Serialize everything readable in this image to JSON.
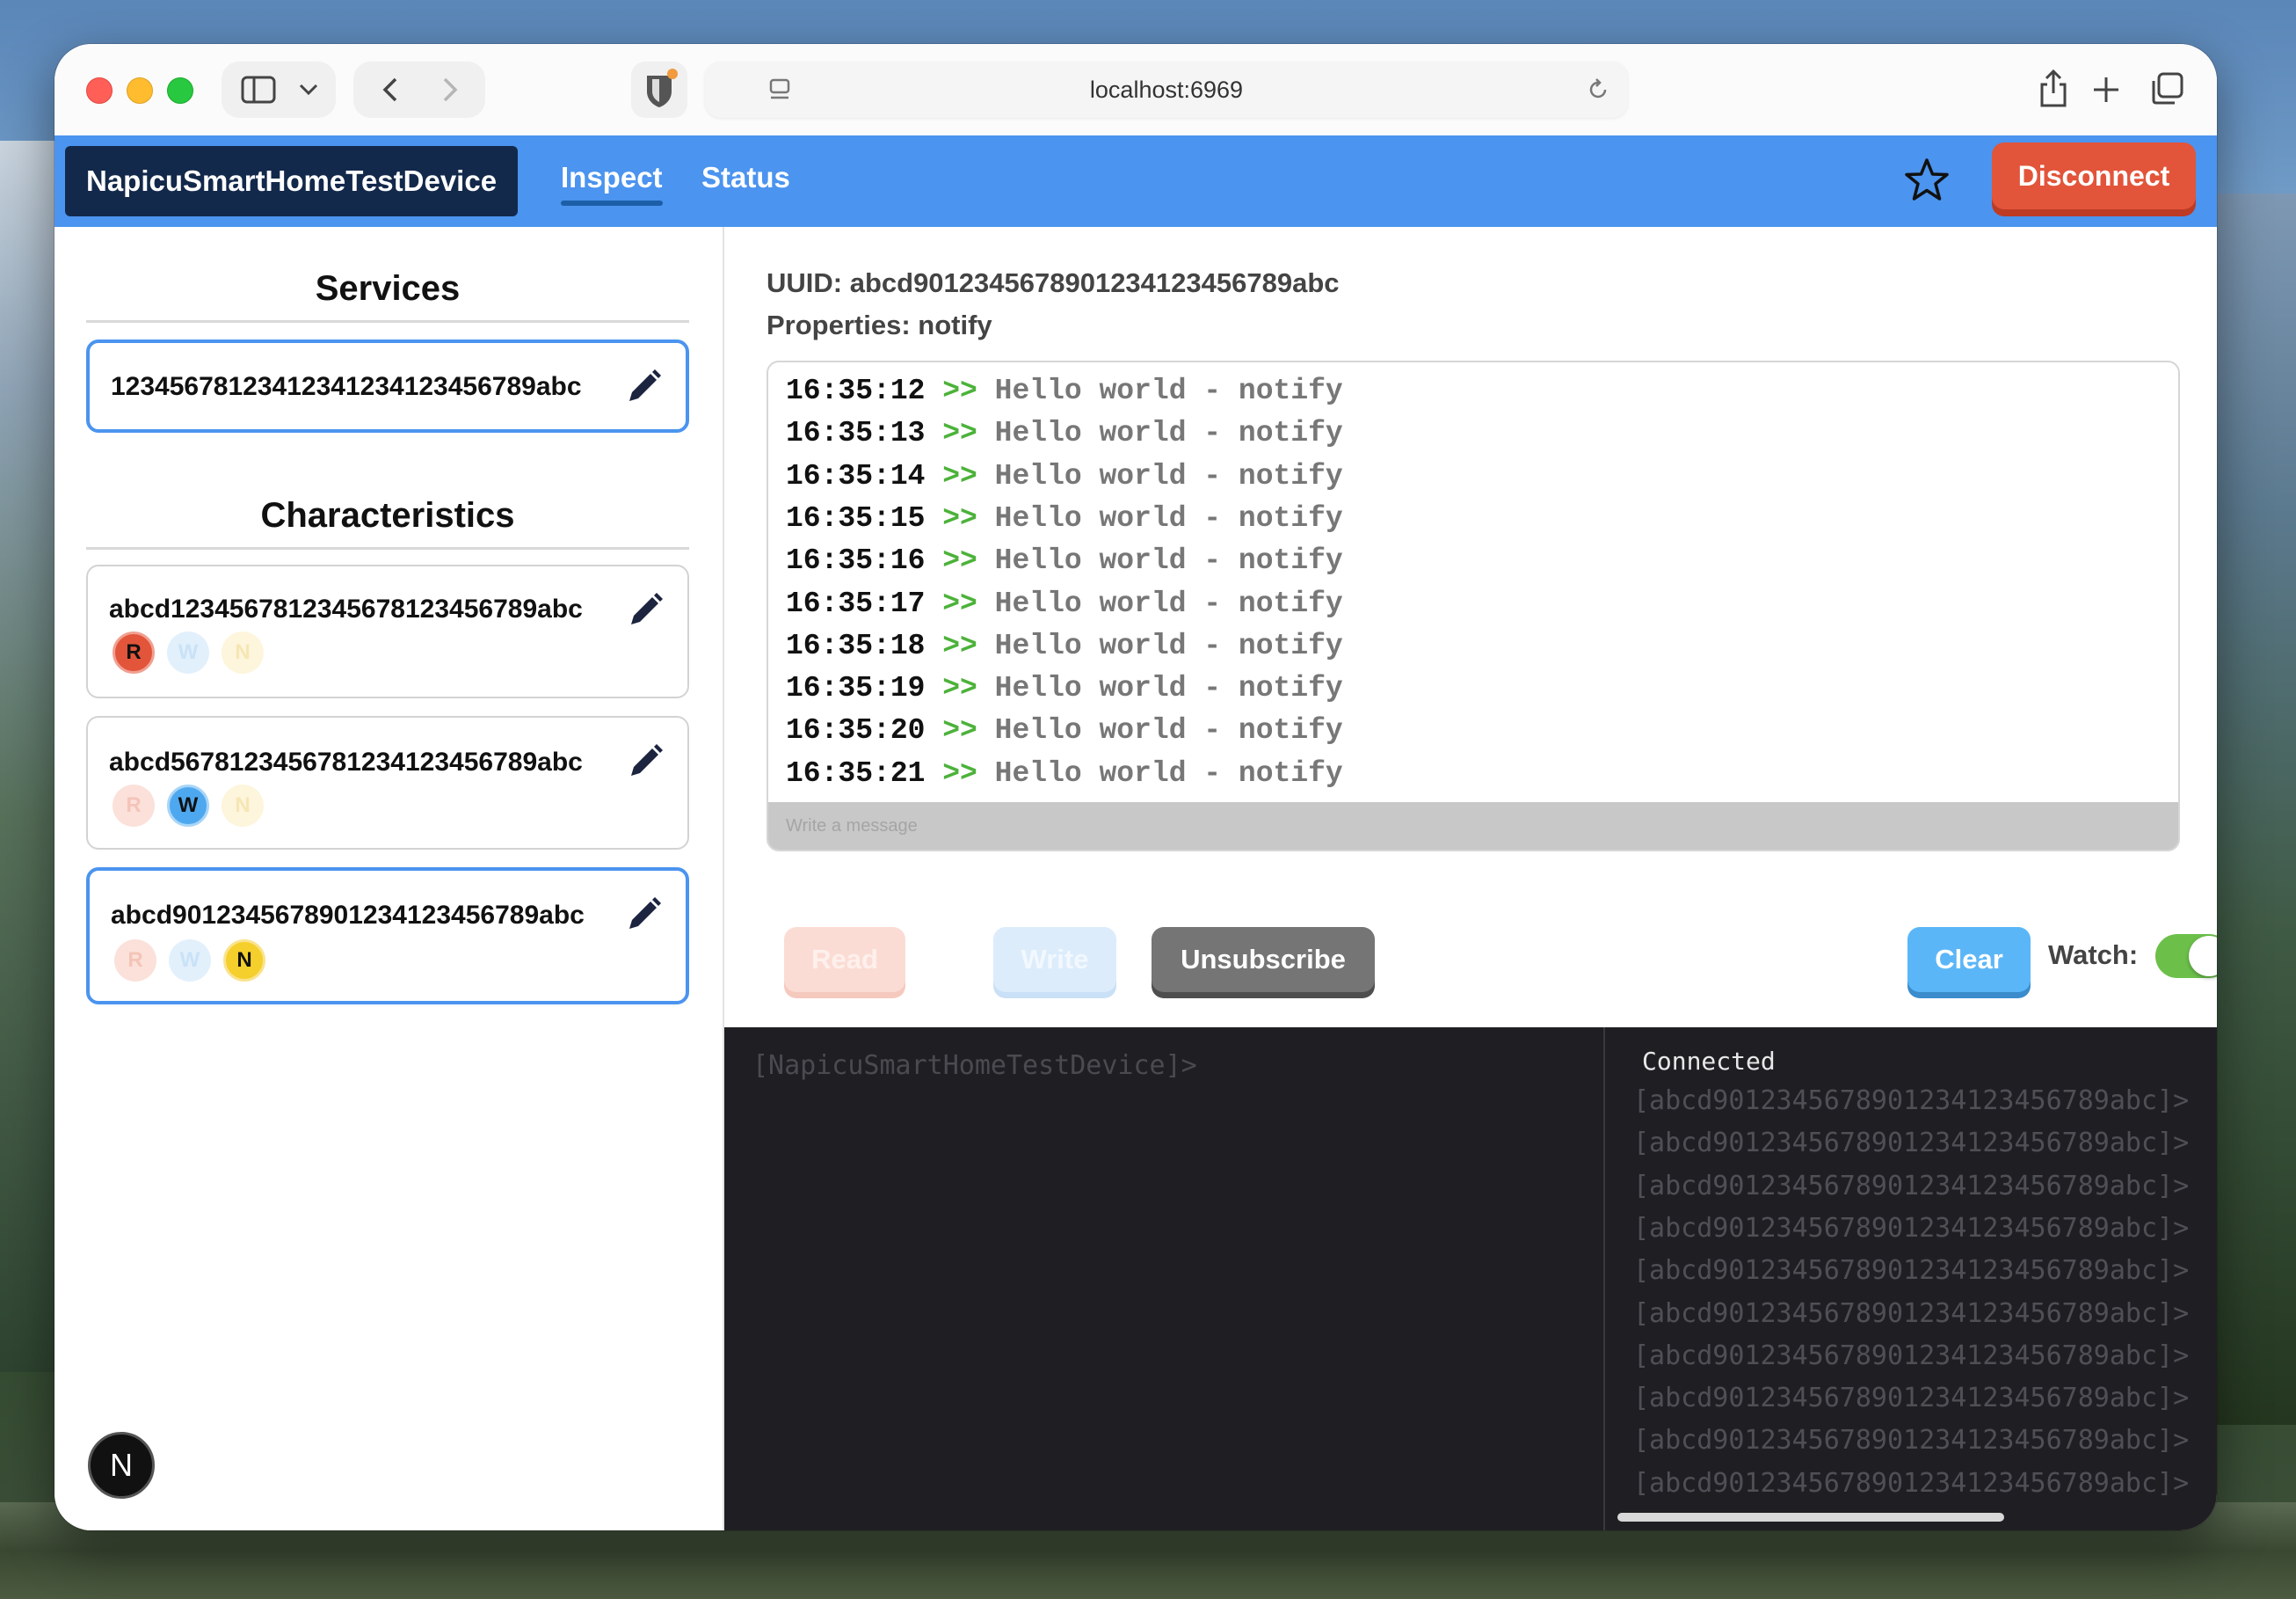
{
  "browser": {
    "url": "localhost:6969"
  },
  "header": {
    "device_name": "NapicuSmartHomeTestDevice",
    "tabs": [
      {
        "label": "Inspect",
        "active": true
      },
      {
        "label": "Status",
        "active": false
      }
    ],
    "disconnect_label": "Disconnect"
  },
  "services": {
    "title": "Services",
    "items": [
      {
        "uuid": "12345678123412341234123456789abc"
      }
    ]
  },
  "characteristics": {
    "title": "Characteristics",
    "items": [
      {
        "uuid": "abcd1234567812345678123456789abc",
        "badges": [
          "R",
          "W",
          "N"
        ],
        "active": [
          "R"
        ]
      },
      {
        "uuid": "abcd5678123456781234123456789abc",
        "badges": [
          "R",
          "W",
          "N"
        ],
        "active": [
          "W"
        ]
      },
      {
        "uuid": "abcd9012345678901234123456789abc",
        "badges": [
          "R",
          "W",
          "N"
        ],
        "active": [
          "N"
        ],
        "selected": true
      }
    ]
  },
  "detail": {
    "uuid_line": "UUID: abcd9012345678901234123456789abc",
    "properties_line": "Properties: notify",
    "log": [
      {
        "time": "16:35:12",
        "arrow": ">>",
        "msg": "Hello world - notify"
      },
      {
        "time": "16:35:13",
        "arrow": ">>",
        "msg": "Hello world - notify"
      },
      {
        "time": "16:35:14",
        "arrow": ">>",
        "msg": "Hello world - notify"
      },
      {
        "time": "16:35:15",
        "arrow": ">>",
        "msg": "Hello world - notify"
      },
      {
        "time": "16:35:16",
        "arrow": ">>",
        "msg": "Hello world - notify"
      },
      {
        "time": "16:35:17",
        "arrow": ">>",
        "msg": "Hello world - notify"
      },
      {
        "time": "16:35:18",
        "arrow": ">>",
        "msg": "Hello world - notify"
      },
      {
        "time": "16:35:19",
        "arrow": ">>",
        "msg": "Hello world - notify"
      },
      {
        "time": "16:35:20",
        "arrow": ">>",
        "msg": "Hello world - notify"
      },
      {
        "time": "16:35:21",
        "arrow": ">>",
        "msg": "Hello world - notify"
      }
    ],
    "message_placeholder": "Write a message",
    "buttons": {
      "read": "Read",
      "write": "Write",
      "unsubscribe": "Unsubscribe",
      "clear": "Clear"
    },
    "watch_label": "Watch:",
    "watch_on": true
  },
  "terminal_left": {
    "prompt": "[NapicuSmartHomeTestDevice]>"
  },
  "terminal_right": {
    "status": "Connected",
    "lines": [
      "[abcd9012345678901234123456789abc]>",
      "[abcd9012345678901234123456789abc]>",
      "[abcd9012345678901234123456789abc]>",
      "[abcd9012345678901234123456789abc]>",
      "[abcd9012345678901234123456789abc]>",
      "[abcd9012345678901234123456789abc]>",
      "[abcd9012345678901234123456789abc]>",
      "[abcd9012345678901234123456789abc]>",
      "[abcd9012345678901234123456789abc]>",
      "[abcd9012345678901234123456789abc]>"
    ]
  },
  "colors": {
    "header_bg": "#4b94ef",
    "device_bg": "#13294b",
    "disconnect": "#e2553a",
    "read": "#e2553a",
    "write": "#4ea8ef",
    "notify": "#f5cf2c",
    "toggle_on": "#6cc04a"
  }
}
